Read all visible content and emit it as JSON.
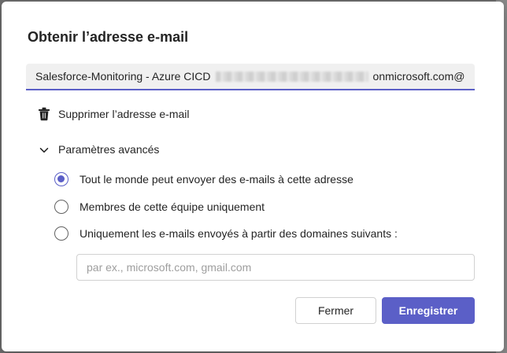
{
  "dialog": {
    "title": "Obtenir l’adresse e-mail",
    "email": {
      "prefix": "Salesforce-Monitoring - Azure CICD",
      "suffix": "onmicrosoft.com@"
    },
    "delete_label": "Supprimer l’adresse e-mail",
    "advanced": {
      "label": "Paramètres avancés",
      "expanded": true,
      "options": [
        {
          "label": "Tout le monde peut envoyer des e-mails à cette adresse",
          "selected": true
        },
        {
          "label": "Membres de cette équipe uniquement",
          "selected": false
        },
        {
          "label": "Uniquement les e-mails envoyés à partir des domaines suivants :",
          "selected": false
        }
      ],
      "domains_placeholder": "par ex., microsoft.com, gmail.com",
      "domains_value": ""
    },
    "buttons": {
      "close_label": "Fermer",
      "save_label": "Enregistrer"
    }
  },
  "colors": {
    "accent": "#5b5fc7",
    "text": "#242424",
    "field_bg": "#f0f0f0"
  },
  "icons": [
    "trash-icon",
    "chevron-down-icon"
  ]
}
